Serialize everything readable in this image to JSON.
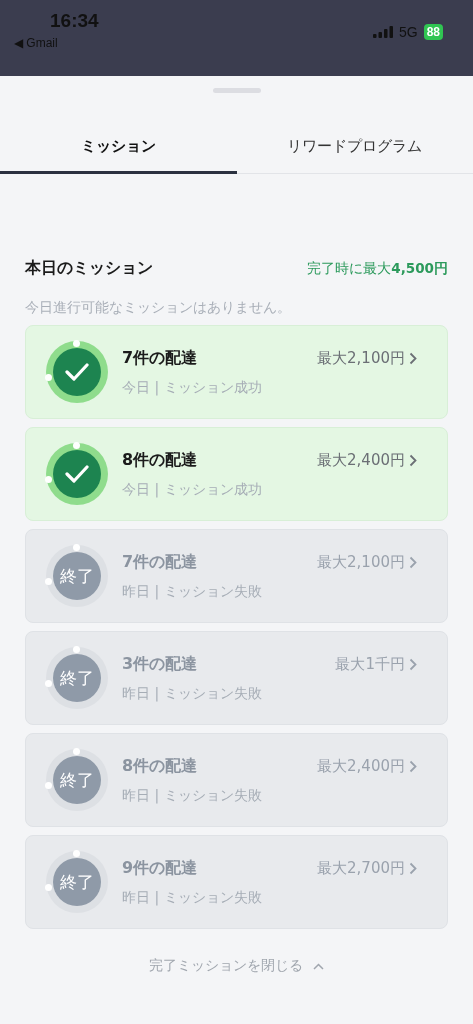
{
  "status_bar": {
    "time": "16:34",
    "back": "◀ Gmail",
    "network": "5G",
    "battery": "88"
  },
  "tabs": [
    {
      "label": "ミッション",
      "selected": true
    },
    {
      "label": "リワードプログラム",
      "selected": false
    }
  ],
  "section": {
    "title": "本日のミッション",
    "reward_prefix": "完了時に最大",
    "reward_amount": "4,500円",
    "note": "今日進行可能なミッションはありません。"
  },
  "missions": [
    {
      "kind": "success",
      "title": "7件の配達",
      "reward": "最大2,100円",
      "status": "今日 | ミッション成功"
    },
    {
      "kind": "success",
      "title": "8件の配達",
      "reward": "最大2,400円",
      "status": "今日 | ミッション成功"
    },
    {
      "kind": "ended",
      "badge": "終了",
      "title": "7件の配達",
      "reward": "最大2,100円",
      "status": "昨日 | ミッション失敗"
    },
    {
      "kind": "ended",
      "badge": "終了",
      "title": "3件の配達",
      "reward": "最大1千円",
      "status": "昨日 | ミッション失敗"
    },
    {
      "kind": "ended",
      "badge": "終了",
      "title": "8件の配達",
      "reward": "最大2,400円",
      "status": "昨日 | ミッション失敗"
    },
    {
      "kind": "ended",
      "badge": "終了",
      "title": "9件の配達",
      "reward": "最大2,700円",
      "status": "昨日 | ミッション失敗"
    }
  ],
  "footer": {
    "close_label": "完了ミッションを閉じる"
  }
}
